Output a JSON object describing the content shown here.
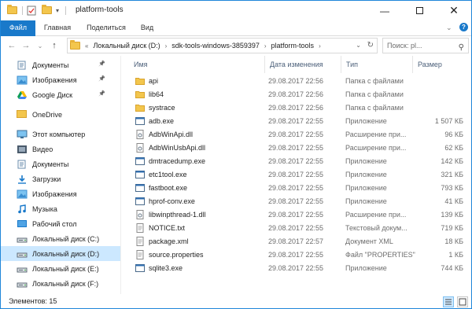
{
  "window": {
    "title": "platform-tools",
    "minimize_icon": "minimize-icon",
    "maximize_icon": "maximize-icon",
    "close_icon": "close-icon"
  },
  "ribbon": {
    "tabs": [
      "Файл",
      "Главная",
      "Поделиться",
      "Вид"
    ],
    "accent": "#1979ca"
  },
  "address": {
    "breadcrumbs": [
      "Локальный диск (D:)",
      "sdk-tools-windows-3859397",
      "platform-tools"
    ],
    "prefix": "«"
  },
  "search": {
    "placeholder": "Поиск: pl..."
  },
  "nav": {
    "items": [
      {
        "label": "Документы",
        "icon": "documents-icon",
        "pinned": true
      },
      {
        "label": "Изображения",
        "icon": "pictures-icon",
        "pinned": true
      },
      {
        "label": "Google Диск",
        "icon": "google-drive-icon",
        "pinned": true
      },
      {
        "label": "OneDrive",
        "icon": "onedrive-icon"
      },
      {
        "label": "Этот компьютер",
        "icon": "computer-icon"
      },
      {
        "label": "Видео",
        "icon": "video-icon"
      },
      {
        "label": "Документы",
        "icon": "documents-icon"
      },
      {
        "label": "Загрузки",
        "icon": "downloads-icon"
      },
      {
        "label": "Изображения",
        "icon": "pictures-icon"
      },
      {
        "label": "Музыка",
        "icon": "music-icon"
      },
      {
        "label": "Рабочий стол",
        "icon": "desktop-icon"
      },
      {
        "label": "Локальный диск (C:)",
        "icon": "drive-icon"
      },
      {
        "label": "Локальный диск (D:)",
        "icon": "drive-icon",
        "selected": true
      },
      {
        "label": "Локальный диск (E:)",
        "icon": "drive-icon"
      },
      {
        "label": "Локальный диск (F:)",
        "icon": "drive-icon"
      }
    ]
  },
  "columns": [
    "Имя",
    "Дата изменения",
    "Тип",
    "Размер"
  ],
  "files": [
    {
      "name": "api",
      "date": "29.08.2017 22:56",
      "type": "Папка с файлами",
      "size": "",
      "icon": "folder"
    },
    {
      "name": "lib64",
      "date": "29.08.2017 22:56",
      "type": "Папка с файлами",
      "size": "",
      "icon": "folder"
    },
    {
      "name": "systrace",
      "date": "29.08.2017 22:56",
      "type": "Папка с файлами",
      "size": "",
      "icon": "folder"
    },
    {
      "name": "adb.exe",
      "date": "29.08.2017 22:55",
      "type": "Приложение",
      "size": "1 507 КБ",
      "icon": "exe"
    },
    {
      "name": "AdbWinApi.dll",
      "date": "29.08.2017 22:55",
      "type": "Расширение при...",
      "size": "96 КБ",
      "icon": "dll"
    },
    {
      "name": "AdbWinUsbApi.dll",
      "date": "29.08.2017 22:55",
      "type": "Расширение при...",
      "size": "62 КБ",
      "icon": "dll"
    },
    {
      "name": "dmtracedump.exe",
      "date": "29.08.2017 22:55",
      "type": "Приложение",
      "size": "142 КБ",
      "icon": "exe"
    },
    {
      "name": "etc1tool.exe",
      "date": "29.08.2017 22:55",
      "type": "Приложение",
      "size": "321 КБ",
      "icon": "exe"
    },
    {
      "name": "fastboot.exe",
      "date": "29.08.2017 22:55",
      "type": "Приложение",
      "size": "793 КБ",
      "icon": "exe"
    },
    {
      "name": "hprof-conv.exe",
      "date": "29.08.2017 22:55",
      "type": "Приложение",
      "size": "41 КБ",
      "icon": "exe"
    },
    {
      "name": "libwinpthread-1.dll",
      "date": "29.08.2017 22:55",
      "type": "Расширение при...",
      "size": "139 КБ",
      "icon": "dll"
    },
    {
      "name": "NOTICE.txt",
      "date": "29.08.2017 22:55",
      "type": "Текстовый докум...",
      "size": "719 КБ",
      "icon": "txt"
    },
    {
      "name": "package.xml",
      "date": "29.08.2017 22:57",
      "type": "Документ XML",
      "size": "18 КБ",
      "icon": "txt"
    },
    {
      "name": "source.properties",
      "date": "29.08.2017 22:55",
      "type": "Файл \"PROPERTIES\"",
      "size": "1 КБ",
      "icon": "txt"
    },
    {
      "name": "sqlite3.exe",
      "date": "29.08.2017 22:55",
      "type": "Приложение",
      "size": "744 КБ",
      "icon": "exe"
    }
  ],
  "status": {
    "items_text": "Элементов: 15"
  }
}
